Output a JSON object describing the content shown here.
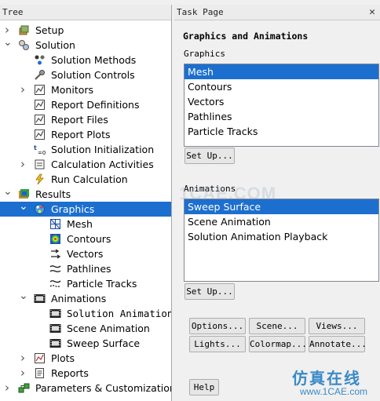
{
  "tree": {
    "header": "Tree",
    "items": [
      {
        "label": "Setup",
        "level": 1,
        "chevron": "right",
        "icon": "setup-icon",
        "selected": false
      },
      {
        "label": "Solution",
        "level": 1,
        "chevron": "down",
        "icon": "solution-icon",
        "selected": false
      },
      {
        "label": "Solution Methods",
        "level": 2,
        "chevron": "",
        "icon": "methods-icon",
        "selected": false
      },
      {
        "label": "Solution Controls",
        "level": 2,
        "chevron": "",
        "icon": "controls-icon",
        "selected": false
      },
      {
        "label": "Monitors",
        "level": 2,
        "chevron": "right",
        "icon": "monitors-icon",
        "selected": false
      },
      {
        "label": "Report Definitions",
        "level": 2,
        "chevron": "",
        "icon": "report-definitions-icon",
        "selected": false
      },
      {
        "label": "Report Files",
        "level": 2,
        "chevron": "",
        "icon": "report-files-icon",
        "selected": false
      },
      {
        "label": "Report Plots",
        "level": 2,
        "chevron": "",
        "icon": "report-plots-icon",
        "selected": false
      },
      {
        "label": "Solution Initialization",
        "level": 2,
        "chevron": "",
        "icon": "initialization-icon",
        "selected": false
      },
      {
        "label": "Calculation Activities",
        "level": 2,
        "chevron": "right",
        "icon": "calculation-activities-icon",
        "selected": false
      },
      {
        "label": "Run Calculation",
        "level": 2,
        "chevron": "",
        "icon": "lightning-icon",
        "selected": false
      },
      {
        "label": "Results",
        "level": 1,
        "chevron": "down",
        "icon": "results-icon",
        "selected": false
      },
      {
        "label": "Graphics",
        "level": 2,
        "chevron": "down",
        "icon": "graphics-icon",
        "selected": true
      },
      {
        "label": "Mesh",
        "level": 3,
        "chevron": "",
        "icon": "mesh-icon",
        "selected": false
      },
      {
        "label": "Contours",
        "level": 3,
        "chevron": "",
        "icon": "contours-icon",
        "selected": false
      },
      {
        "label": "Vectors",
        "level": 3,
        "chevron": "",
        "icon": "vectors-icon",
        "selected": false
      },
      {
        "label": "Pathlines",
        "level": 3,
        "chevron": "",
        "icon": "pathlines-icon",
        "selected": false
      },
      {
        "label": "Particle Tracks",
        "level": 3,
        "chevron": "",
        "icon": "particle-tracks-icon",
        "selected": false
      },
      {
        "label": "Animations",
        "level": 2,
        "chevron": "down",
        "icon": "film-icon",
        "selected": false
      },
      {
        "label": "Solution Animation …",
        "level": 3,
        "chevron": "",
        "icon": "film-icon",
        "selected": false
      },
      {
        "label": "Scene Animation",
        "level": 3,
        "chevron": "",
        "icon": "film-icon",
        "selected": false
      },
      {
        "label": "Sweep Surface",
        "level": 3,
        "chevron": "",
        "icon": "film-icon",
        "selected": false
      },
      {
        "label": "Plots",
        "level": 2,
        "chevron": "right",
        "icon": "plots-icon",
        "selected": false
      },
      {
        "label": "Reports",
        "level": 2,
        "chevron": "right",
        "icon": "reports-icon",
        "selected": false
      },
      {
        "label": "Parameters & Customization",
        "level": 1,
        "chevron": "right",
        "icon": "parameters-icon",
        "selected": false
      }
    ]
  },
  "task_page": {
    "header": "Task Page",
    "close_glyph": "✕",
    "title": "Graphics and Animations",
    "graphics_label": "Graphics",
    "graphics_items": [
      "Mesh",
      "Contours",
      "Vectors",
      "Pathlines",
      "Particle Tracks"
    ],
    "graphics_selected": 0,
    "setup_label": "Set Up...",
    "animations_label": "Animations",
    "animation_items": [
      "Sweep Surface",
      "Scene Animation",
      "Solution Animation Playback"
    ],
    "animations_selected": 0,
    "buttons": {
      "options": "Options...",
      "scene": "Scene...",
      "views": "Views...",
      "lights": "Lights...",
      "colormap": "Colormap...",
      "annotate": "Annotate...",
      "help": "Help"
    }
  },
  "watermarks": {
    "center": "1CAE.COM",
    "logo_cn": "仿真在线",
    "logo_url": "www.1CAE.com"
  },
  "colors": {
    "selection": "#1c6fcf",
    "watermark": "#3a8ac8"
  }
}
